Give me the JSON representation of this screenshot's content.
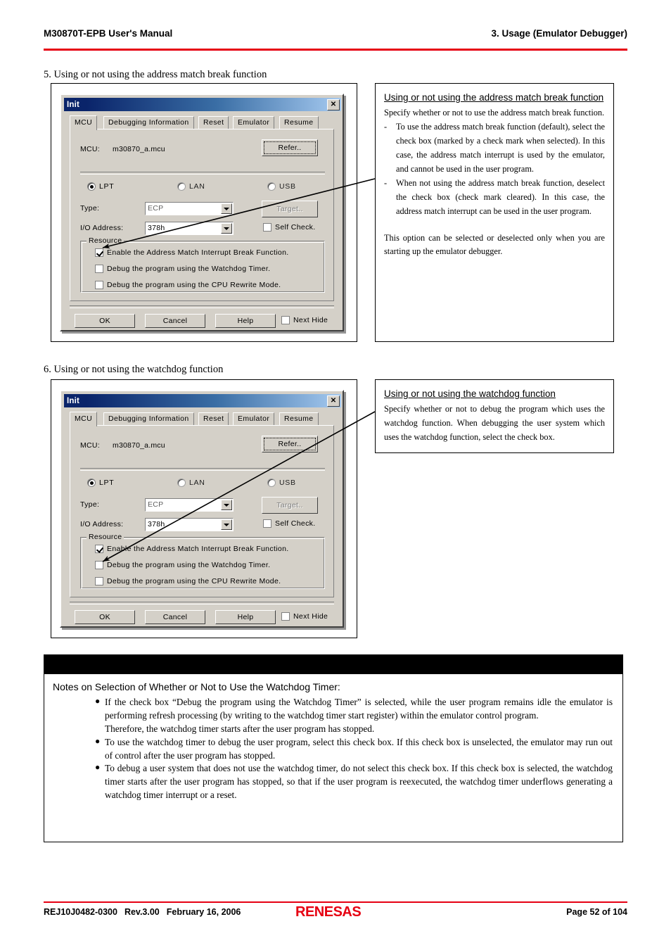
{
  "header": {
    "left": "M30870T-EPB User's Manual",
    "right": "3. Usage (Emulator Debugger)",
    "rule_color": "#e60012"
  },
  "sections": {
    "item5": "5. Using or not using the address match break function",
    "item6": "6. Using or not using the watchdog function"
  },
  "dialog": {
    "title": "Init",
    "close_label": "✕",
    "tabs": [
      {
        "label": "MCU",
        "active": true
      },
      {
        "label": "Debugging Information",
        "active": false
      },
      {
        "label": "Reset",
        "active": false
      },
      {
        "label": "Emulator",
        "active": false
      },
      {
        "label": "Resume",
        "active": false
      }
    ],
    "mcu_label": "MCU:",
    "mcu_value": "m30870_a.mcu",
    "refer_button": "Refer..",
    "connection": [
      {
        "label": "LPT",
        "selected": true
      },
      {
        "label": "LAN",
        "selected": false
      },
      {
        "label": "USB",
        "selected": false
      }
    ],
    "type_label": "Type:",
    "type_value": "ECP",
    "io_label": "I/O Address:",
    "io_value": "378h",
    "target_button": "Target..",
    "self_check": "Self Check.",
    "resource_group": "Resource",
    "resource_items_dialog1": [
      {
        "label": "Enable the Address Match Interrupt Break Function.",
        "checked": true
      },
      {
        "label": "Debug the program using the Watchdog Timer.",
        "checked": false
      },
      {
        "label": "Debug the program using the CPU Rewrite Mode.",
        "checked": false
      }
    ],
    "resource_items_dialog2": [
      {
        "label": "Enable the Address Match Interrupt Break Function.",
        "checked": true
      },
      {
        "label": "Debug the program using the Watchdog Timer.",
        "checked": false
      },
      {
        "label": "Debug the program using the CPU Rewrite Mode.",
        "checked": false
      }
    ],
    "ok_button": "OK",
    "cancel_button": "Cancel",
    "help_button": "Help",
    "next_hide": "Next Hide"
  },
  "callout1": {
    "title": "Using or not using the address match break function",
    "para1": "Specify whether or not to use the address match break function.",
    "dash": "-",
    "bullet1": "To use the address match break function (default), select the check box (marked by a check mark when selected). In this case, the address match interrupt is used by the emulator, and cannot be used in the user program.",
    "bullet2": "When not using the address match break function, deselect the check box (check mark cleared). In this case, the address match interrupt can be used in the user program.",
    "para2": "This option can be selected or deselected only when you are starting up the emulator debugger."
  },
  "callout2": {
    "title": "Using or not using the watchdog function",
    "para1": "Specify whether or not to debug the program which uses the watchdog function. When debugging the user system which uses the watchdog function, select the check box."
  },
  "notes": {
    "title": "Notes on Selection of Whether or Not to Use the Watchdog Timer:",
    "bullet": "●",
    "items": [
      "If the check box “Debug the program using the Watchdog Timer” is selected, while the user program    remains idle the emulator is performing refresh processing (by writing to the watchdog timer start register) within the emulator control program.",
      "To use the watchdog timer to debug the user program, select this check box. If this check box is unselected, the emulator may run out of control after the user program has stopped.",
      "To debug a user system that does not use the watchdog timer, do not select this check box. If this check box is selected, the watchdog timer starts after the user program has stopped, so that if the user program is reexecuted, the watchdog timer underflows generating a watchdog timer interrupt or a reset."
    ],
    "sub_after_first": "Therefore, the watchdog timer starts after the user program has stopped."
  },
  "footer": {
    "doc_number": "REJ10J0482-0300",
    "revision": "Rev.3.00",
    "date": "February 16, 2006",
    "brand": "RENESAS",
    "page": "Page 52 of 104",
    "rule_color": "#e60012"
  }
}
